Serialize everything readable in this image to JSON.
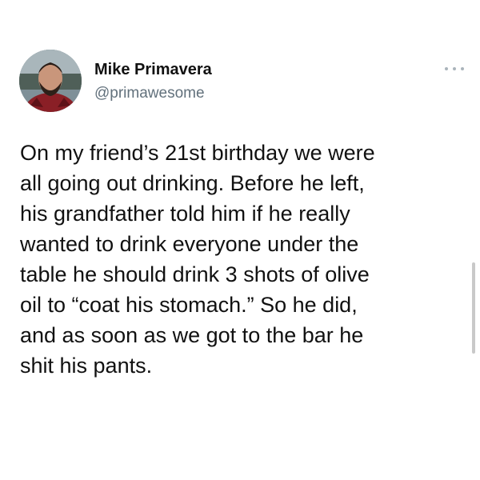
{
  "author": {
    "name": "Mike Primavera",
    "handle": "@primawesome",
    "avatar_icon": "profile-photo"
  },
  "more_icon": "more-options-icon",
  "tweet_text_lines": [
    "On my friend’s 21st birthday we were",
    "all going out drinking. Before he left,",
    "his grandfather told him if he really",
    "wanted to drink everyone under the",
    "table he should drink 3 shots of olive",
    "oil to “coat his stomach.” So he did,",
    "and as soon as we got to the bar he",
    "shit his pants."
  ],
  "colors": {
    "name": "#111111",
    "handle": "#62717c",
    "text": "#111111",
    "background": "#ffffff"
  }
}
